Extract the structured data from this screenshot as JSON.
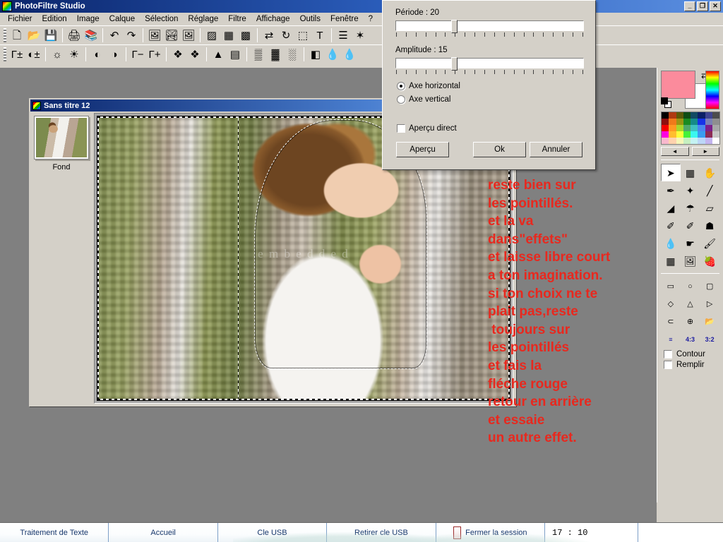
{
  "app": {
    "title": "PhotoFiltre Studio",
    "window_buttons": [
      {
        "name": "minimize",
        "glyph": "_"
      },
      {
        "name": "restore",
        "glyph": "❐"
      },
      {
        "name": "close",
        "glyph": "✕"
      }
    ],
    "menu": [
      "Fichier",
      "Edition",
      "Image",
      "Calque",
      "Sélection",
      "Réglage",
      "Filtre",
      "Affichage",
      "Outils",
      "Fenêtre",
      "?"
    ]
  },
  "toolbar_main": [
    {
      "name": "new-document-icon",
      "glyph": "🗋"
    },
    {
      "name": "open-folder-icon",
      "glyph": "📂"
    },
    {
      "name": "save-disk-icon",
      "glyph": "💾"
    },
    {
      "sep": true
    },
    {
      "name": "print-icon",
      "glyph": "🖨"
    },
    {
      "name": "print-preview-icon",
      "glyph": "📚"
    },
    {
      "sep": true
    },
    {
      "name": "undo-icon",
      "glyph": "↶"
    },
    {
      "name": "redo-icon",
      "glyph": "↷"
    },
    {
      "sep": true
    },
    {
      "name": "copy-image-icon",
      "glyph": "🖼"
    },
    {
      "name": "paste-transparency-icon",
      "glyph": "🏞"
    },
    {
      "name": "duplicate-image-icon",
      "glyph": "🖼"
    },
    {
      "sep": true
    },
    {
      "name": "grayscale-icon",
      "glyph": "▨"
    },
    {
      "name": "color-mode-icon",
      "glyph": "▦"
    },
    {
      "name": "transparency-icon",
      "glyph": "▩"
    },
    {
      "sep": true
    },
    {
      "name": "flip-horizontal-icon",
      "glyph": "⇄"
    },
    {
      "name": "rotate-icon",
      "glyph": "↻"
    },
    {
      "name": "selection-icon",
      "glyph": "⬚"
    },
    {
      "name": "text-tool-icon",
      "glyph": "T"
    },
    {
      "sep": true
    },
    {
      "name": "layers-icon",
      "glyph": "☰"
    },
    {
      "name": "effects-icon",
      "glyph": "✶"
    }
  ],
  "toolbar_adjust": [
    {
      "name": "auto-gamma-icon",
      "glyph": "Γ±"
    },
    {
      "name": "auto-contrast-icon",
      "glyph": "◐±"
    },
    {
      "sep": true
    },
    {
      "name": "brightness-minus-icon",
      "glyph": "☼"
    },
    {
      "name": "brightness-plus-icon",
      "glyph": "☀"
    },
    {
      "sep": true
    },
    {
      "name": "contrast-minus-icon",
      "glyph": "◐"
    },
    {
      "name": "contrast-plus-icon",
      "glyph": "◑"
    },
    {
      "sep": true
    },
    {
      "name": "gamma-minus-icon",
      "glyph": "Γ−"
    },
    {
      "name": "gamma-plus-icon",
      "glyph": "Γ+"
    },
    {
      "sep": true
    },
    {
      "name": "saturation-minus-icon",
      "glyph": "❖"
    },
    {
      "name": "saturation-plus-icon",
      "glyph": "❖"
    },
    {
      "sep": true
    },
    {
      "name": "histogram-icon",
      "glyph": "▲"
    },
    {
      "name": "levels-icon",
      "glyph": "▤"
    },
    {
      "sep": true
    },
    {
      "name": "grid-dark-icon",
      "glyph": "▒"
    },
    {
      "name": "grid-medium-icon",
      "glyph": "▓"
    },
    {
      "name": "grid-light-icon",
      "glyph": "░"
    },
    {
      "sep": true
    },
    {
      "name": "mask-icon",
      "glyph": "◧"
    },
    {
      "name": "blur-drop-icon",
      "glyph": "💧"
    },
    {
      "name": "blur-more-icon",
      "glyph": "💧"
    }
  ],
  "image_window": {
    "title": "Sans titre 12",
    "layer_label": "Fond",
    "watermark": "e m b e d d e d"
  },
  "dialog": {
    "period_label": "Période : 20",
    "period_value": 20,
    "amplitude_label": "Amplitude : 15",
    "amplitude_value": 15,
    "radio_horizontal": "Axe horizontal",
    "radio_vertical": "Axe vertical",
    "checkbox_preview": "Aperçu direct",
    "button_preview": "Aperçu",
    "button_ok": "Ok",
    "button_cancel": "Annuler"
  },
  "annotation": {
    "color": "#e8281e",
    "lines": [
      "reste bien sur",
      "les pointillés.",
      "et la va",
      "dans\"effets\"",
      "et laisse libre court",
      "a ton imagination.",
      "si ton choix ne te",
      "plait pas,reste",
      " toujours sur",
      "les pointillés",
      "et fais la",
      "fléche rouge",
      "retour en arrière",
      "et essaie",
      "un autre effet."
    ]
  },
  "dock": {
    "foreground_color": "#fb8b9c",
    "background_color": "#ffffff",
    "swap_icon": "swap-colors-icon",
    "palette": [
      "#000000",
      "#b03a12",
      "#5c5a08",
      "#0f4d13",
      "#114a63",
      "#0d2066",
      "#3f4391",
      "#4c4c4c",
      "#8e0f0f",
      "#f07a1a",
      "#9a9414",
      "#1a8c22",
      "#158b89",
      "#1732e8",
      "#7b80b4",
      "#8f8f8f",
      "#f40000",
      "#ff9a22",
      "#a8d62a",
      "#4fa86a",
      "#3fc0c0",
      "#4a86f0",
      "#7b1f8c",
      "#a8a8a8",
      "#ff00e0",
      "#ffbe2e",
      "#fbff3a",
      "#45f03a",
      "#3bf7f0",
      "#3a9cf0",
      "#8c2b55",
      "#c6c6c6",
      "#f9b8cd",
      "#ffd2ae",
      "#f6f6b8",
      "#c6efc0",
      "#c5f2f2",
      "#bcd6f7",
      "#c3b4ef",
      "#ffffff"
    ],
    "prev_label": "◄",
    "next_label": "►",
    "tools": [
      {
        "name": "pointer-tool-icon",
        "glyph": "➤",
        "selected": true
      },
      {
        "name": "selection-tool-icon",
        "glyph": "▦",
        "selected": false
      },
      {
        "name": "hand-tool-icon",
        "glyph": "✋",
        "selected": false
      },
      {
        "name": "eyedropper-tool-icon",
        "glyph": "✒",
        "selected": false
      },
      {
        "name": "magic-wand-tool-icon",
        "glyph": "✦",
        "selected": false
      },
      {
        "name": "line-tool-icon",
        "glyph": "╱",
        "selected": false
      },
      {
        "name": "paint-bucket-tool-icon",
        "glyph": "◢",
        "selected": false
      },
      {
        "name": "spray-tool-icon",
        "glyph": "☂",
        "selected": false
      },
      {
        "name": "eraser-tool-icon",
        "glyph": "▱",
        "selected": false
      },
      {
        "name": "brush-tool-icon",
        "glyph": "✐",
        "selected": false
      },
      {
        "name": "brush-plus-tool-icon",
        "glyph": "✐",
        "selected": false
      },
      {
        "name": "stamp-tool-icon",
        "glyph": "☗",
        "selected": false
      },
      {
        "name": "water-drop-tool-icon",
        "glyph": "💧",
        "selected": false
      },
      {
        "name": "smudge-tool-icon",
        "glyph": "☛",
        "selected": false
      },
      {
        "name": "broom-tool-icon",
        "glyph": "🖌",
        "selected": false
      },
      {
        "name": "grid-tool-icon",
        "glyph": "▦",
        "selected": false
      },
      {
        "name": "portrait-tool-icon",
        "glyph": "🖼",
        "selected": false
      },
      {
        "name": "strawberry-tool-icon",
        "glyph": "🍓",
        "selected": false
      }
    ],
    "shapes": [
      {
        "name": "rectangle-shape-icon",
        "glyph": "▭"
      },
      {
        "name": "ellipse-shape-icon",
        "glyph": "○"
      },
      {
        "name": "rounded-rect-shape-icon",
        "glyph": "▢"
      },
      {
        "name": "diamond-shape-icon",
        "glyph": "◇"
      },
      {
        "name": "triangle-shape-icon",
        "glyph": "△"
      },
      {
        "name": "right-triangle-shape-icon",
        "glyph": "▷"
      },
      {
        "name": "lasso-shape-icon",
        "glyph": "⊂"
      },
      {
        "name": "polygon-shape-icon",
        "glyph": "⊕"
      },
      {
        "name": "open-shape-icon",
        "glyph": "📂"
      },
      {
        "name": "ratio-free-icon",
        "glyph": "≡"
      },
      {
        "name": "ratio-4-3-icon",
        "glyph": "4:3"
      },
      {
        "name": "ratio-3-2-icon",
        "glyph": "3:2"
      }
    ],
    "option_contour": "Contour",
    "option_remplir": "Remplir"
  },
  "taskbar": {
    "items": [
      {
        "label": "Traitement de Texte",
        "icon": false
      },
      {
        "label": "Accueil",
        "icon": false
      },
      {
        "label": "Cle USB",
        "icon": false
      },
      {
        "label": "Retirer cle USB",
        "icon": false
      },
      {
        "label": "Fermer la session",
        "icon": true
      }
    ],
    "clock": "17 : 10"
  }
}
